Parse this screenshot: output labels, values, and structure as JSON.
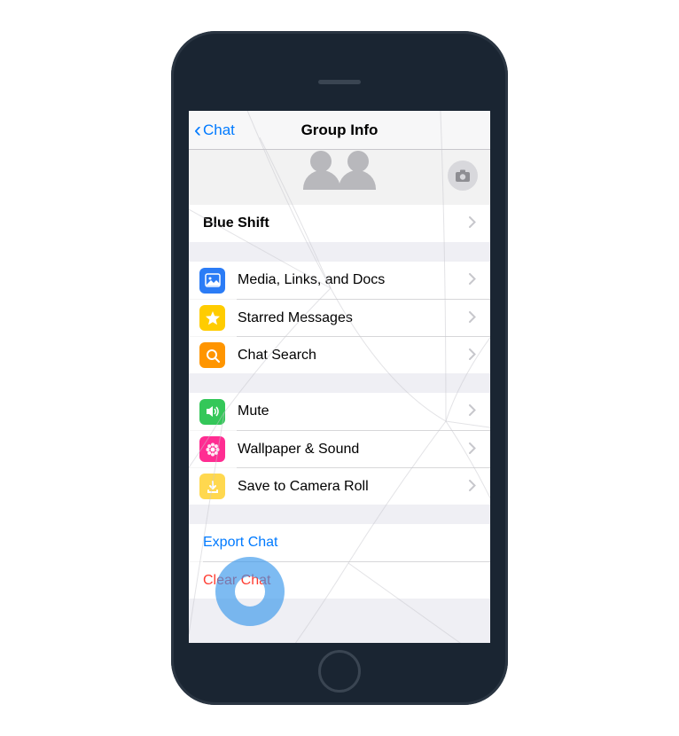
{
  "navbar": {
    "back_label": "Chat",
    "title": "Group Info"
  },
  "group_name": "Blue Shift",
  "sections": {
    "media": {
      "media_links": "Media, Links, and Docs",
      "starred": "Starred Messages",
      "search": "Chat Search"
    },
    "settings": {
      "mute": "Mute",
      "wallpaper": "Wallpaper & Sound",
      "save": "Save to Camera Roll"
    },
    "actions": {
      "export": "Export Chat",
      "clear": "Clear Chat"
    }
  }
}
